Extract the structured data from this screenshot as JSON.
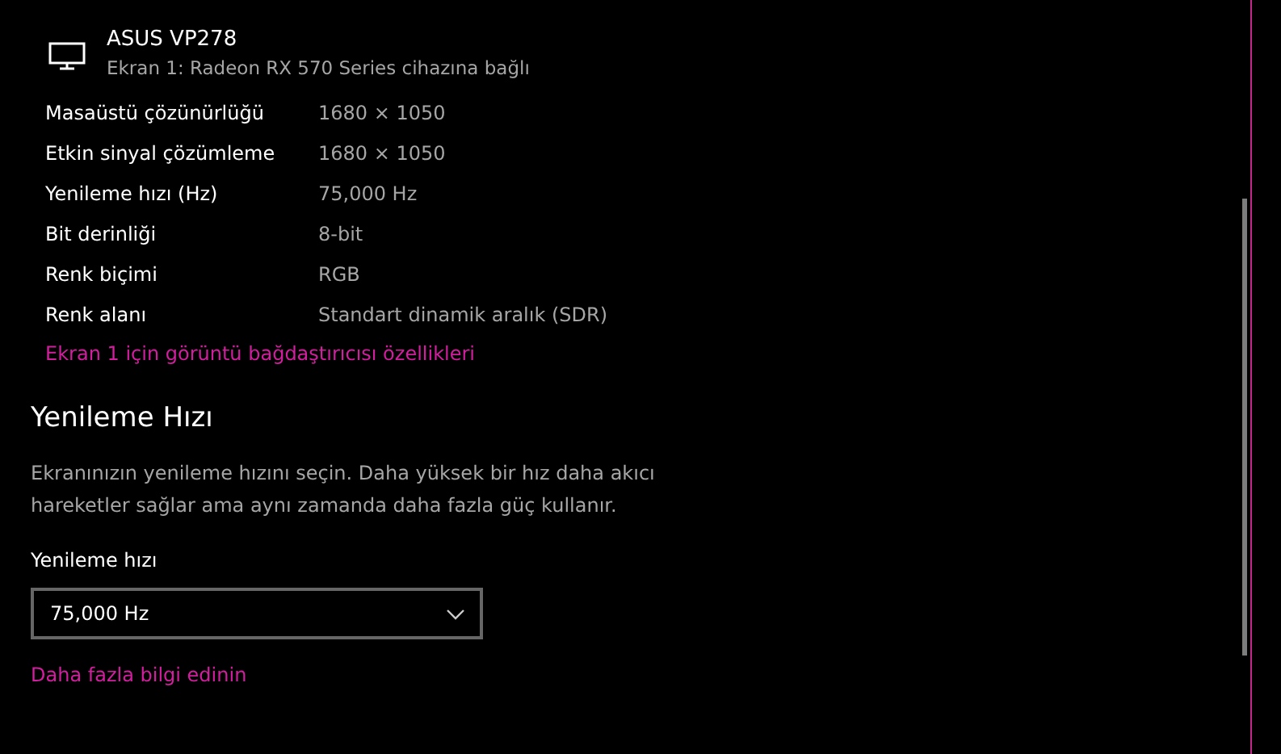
{
  "monitor": {
    "name": "ASUS VP278",
    "connection": "Ekran 1: Radeon RX 570 Series cihazına bağlı"
  },
  "properties": [
    {
      "label": "Masaüstü çözünürlüğü",
      "value": "1680 × 1050"
    },
    {
      "label": "Etkin sinyal çözümleme",
      "value": "1680 × 1050"
    },
    {
      "label": "Yenileme hızı (Hz)",
      "value": "75,000 Hz"
    },
    {
      "label": "Bit derinliği",
      "value": "8-bit"
    },
    {
      "label": "Renk biçimi",
      "value": "RGB"
    },
    {
      "label": "Renk alanı",
      "value": "Standart dinamik aralık (SDR)"
    }
  ],
  "adapter_link": "Ekran 1 için görüntü bağdaştırıcısı özellikleri",
  "refresh_section": {
    "heading": "Yenileme Hızı",
    "description": "Ekranınızın yenileme hızını seçin. Daha yüksek bir hız daha akıcı hareketler sağlar ama aynı zamanda daha fazla güç kullanır.",
    "field_label": "Yenileme hızı",
    "dropdown_value": "75,000 Hz",
    "more_info_link": "Daha fazla bilgi edinin"
  }
}
